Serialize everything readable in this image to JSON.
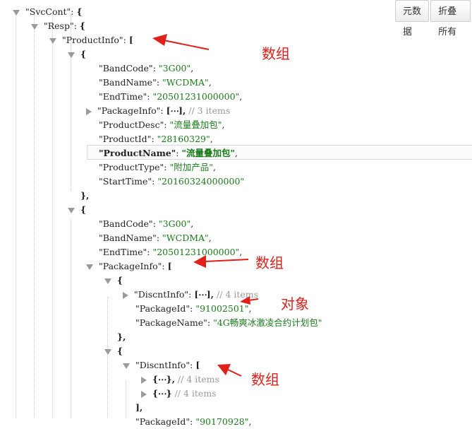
{
  "toolbar": {
    "raw_label": "元数据",
    "collapse_label": "折叠所有"
  },
  "tree": [
    {
      "indent": 0,
      "tri": "down",
      "key": "\"SvcCont\"",
      "sep": ": ",
      "open": "{"
    },
    {
      "indent": 1,
      "tri": "down",
      "key": "\"Resp\"",
      "sep": ": ",
      "open": "{"
    },
    {
      "indent": 2,
      "tri": "down",
      "key": "\"ProductInfo\"",
      "sep": ": ",
      "open": "["
    },
    {
      "indent": 3,
      "tri": "down",
      "open": "{"
    },
    {
      "indent": 4,
      "key": "\"BandCode\"",
      "sep": ": ",
      "val": "\"3G00\"",
      "tail": ","
    },
    {
      "indent": 4,
      "key": "\"BandName\"",
      "sep": ": ",
      "val": "\"WCDMA\"",
      "tail": ","
    },
    {
      "indent": 4,
      "key": "\"EndTime\"",
      "sep": ": ",
      "val": "\"20501231000000\"",
      "tail": ","
    },
    {
      "indent": 4,
      "tri": "right",
      "key": "\"PackageInfo\"",
      "sep": ": ",
      "open": "[",
      "dots": "⋯",
      "close": "],",
      "cmt": "// 3 items"
    },
    {
      "indent": 4,
      "key": "\"ProductDesc\"",
      "sep": ": ",
      "val": "\"流量叠加包\"",
      "tail": ","
    },
    {
      "indent": 4,
      "key": "\"ProductId\"",
      "sep": ": ",
      "val": "\"28160329\"",
      "tail": ","
    },
    {
      "indent": 4,
      "key": "\"ProductName\"",
      "sep": ": ",
      "val": "\"流量叠加包\"",
      "tail": ",",
      "hl": true
    },
    {
      "indent": 4,
      "key": "\"ProductType\"",
      "sep": ": ",
      "val": "\"附加产品\"",
      "tail": ","
    },
    {
      "indent": 4,
      "key": "\"StartTime\"",
      "sep": ": ",
      "val": "\"20160324000000\""
    },
    {
      "indent": 3,
      "close": "},"
    },
    {
      "indent": 3,
      "tri": "down",
      "open": "{"
    },
    {
      "indent": 4,
      "key": "\"BandCode\"",
      "sep": ": ",
      "val": "\"3G00\"",
      "tail": ","
    },
    {
      "indent": 4,
      "key": "\"BandName\"",
      "sep": ": ",
      "val": "\"WCDMA\"",
      "tail": ","
    },
    {
      "indent": 4,
      "key": "\"EndTime\"",
      "sep": ": ",
      "val": "\"20501231000000\"",
      "tail": ","
    },
    {
      "indent": 4,
      "tri": "down",
      "key": "\"PackageInfo\"",
      "sep": ": ",
      "open": "["
    },
    {
      "indent": 5,
      "tri": "down",
      "open": "{"
    },
    {
      "indent": 6,
      "tri": "right",
      "key": "\"DiscntInfo\"",
      "sep": ": ",
      "open": "[",
      "dots": "⋯",
      "close": "],",
      "cmt": "// 4 items"
    },
    {
      "indent": 6,
      "key": "\"PackageId\"",
      "sep": ": ",
      "val": "\"91002501\"",
      "tail": ","
    },
    {
      "indent": 6,
      "key": "\"PackageName\"",
      "sep": ": ",
      "val": "\"4G畅爽冰激凌合约计划包\""
    },
    {
      "indent": 5,
      "close": "},"
    },
    {
      "indent": 5,
      "tri": "down",
      "open": "{"
    },
    {
      "indent": 6,
      "tri": "down",
      "key": "\"DiscntInfo\"",
      "sep": ": ",
      "open": "["
    },
    {
      "indent": 7,
      "tri": "right",
      "open": "{",
      "dots": "⋯",
      "close": "},",
      "cmt": "// 4 items"
    },
    {
      "indent": 7,
      "tri": "right",
      "open": "{",
      "dots": "⋯",
      "close": "}",
      "cmt": "// 4 items"
    },
    {
      "indent": 6,
      "close": "],"
    },
    {
      "indent": 6,
      "key": "\"PackageId\"",
      "sep": ": ",
      "val": "\"90170928\"",
      "tail": ","
    }
  ],
  "annotations": [
    "数组",
    "数组",
    "对象",
    "数组"
  ]
}
